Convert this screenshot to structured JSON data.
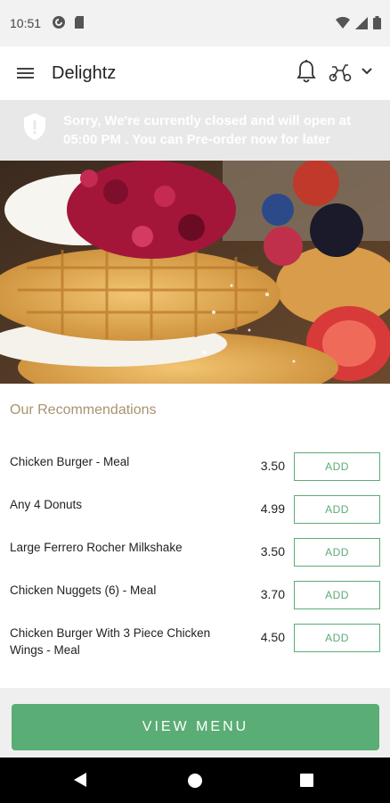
{
  "status_bar": {
    "time": "10:51",
    "left_icons": [
      "pocket-casts-icon",
      "sd-card-icon"
    ],
    "right_icons": [
      "wifi-icon",
      "signal-icon",
      "battery-icon"
    ]
  },
  "app_bar": {
    "title": "Delightz",
    "icons": [
      "menu-icon",
      "bell-icon",
      "scooter-icon",
      "chevron-down-icon"
    ]
  },
  "banner": {
    "text": "Sorry, We're currently closed and will open at 05:00 PM . You can Pre-order now for later",
    "icon": "shield-icon"
  },
  "hero": {
    "description_icon": "waffle-with-berries-image"
  },
  "recommendations": {
    "title": "Our Recommendations",
    "items": [
      {
        "name": "Chicken Burger - Meal",
        "price": "3.50",
        "button": "ADD"
      },
      {
        "name": "Any 4 Donuts",
        "price": "4.99",
        "button": "ADD"
      },
      {
        "name": "Large Ferrero Rocher Milkshake",
        "price": "3.50",
        "button": "ADD"
      },
      {
        "name": "Chicken Nuggets (6) - Meal",
        "price": "3.70",
        "button": "ADD"
      },
      {
        "name": "Chicken Burger With 3 Piece Chicken Wings - Meal",
        "price": "4.50",
        "button": "ADD"
      }
    ]
  },
  "footer": {
    "view_menu_label": "VIEW MENU"
  },
  "colors": {
    "accent": "#5aad75",
    "section_title": "#a89370",
    "banner_bg": "#e8e8e8"
  }
}
